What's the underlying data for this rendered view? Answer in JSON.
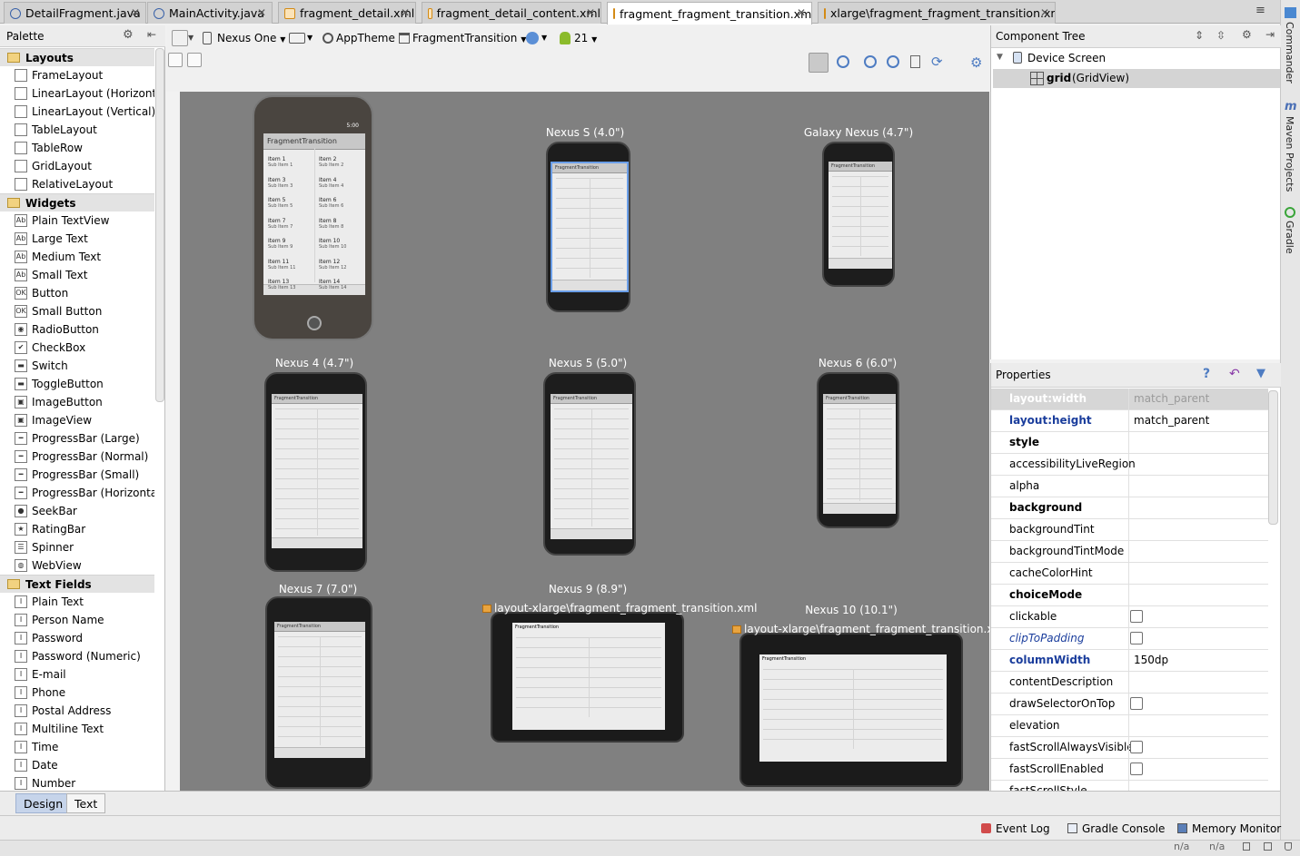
{
  "tabs": [
    {
      "label": "DetailFragment.java",
      "type": "java",
      "active": false
    },
    {
      "label": "MainActivity.java",
      "type": "java",
      "active": false
    },
    {
      "label": "fragment_detail.xml",
      "type": "xml",
      "active": false
    },
    {
      "label": "fragment_detail_content.xml",
      "type": "xml",
      "active": false
    },
    {
      "label": "fragment_fragment_transition.xml",
      "type": "xml",
      "active": true
    },
    {
      "label": "xlarge\\fragment_fragment_transition.xml",
      "type": "xml",
      "active": false
    }
  ],
  "tab_overflow": "≡",
  "side_tools": {
    "commander": "Commander",
    "maven": "Maven Projects",
    "gradle": "Gradle"
  },
  "palette": {
    "title": "Palette",
    "categories": [
      {
        "name": "Layouts",
        "items": [
          {
            "label": "FrameLayout",
            "icon": "frame-layout-icon"
          },
          {
            "label": "LinearLayout (Horizontal)",
            "icon": "linear-horizontal-icon"
          },
          {
            "label": "LinearLayout (Vertical)",
            "icon": "linear-vertical-icon"
          },
          {
            "label": "TableLayout",
            "icon": "table-layout-icon"
          },
          {
            "label": "TableRow",
            "icon": "table-row-icon"
          },
          {
            "label": "GridLayout",
            "icon": "grid-layout-icon"
          },
          {
            "label": "RelativeLayout",
            "icon": "relative-layout-icon"
          }
        ]
      },
      {
        "name": "Widgets",
        "items": [
          {
            "label": "Plain TextView",
            "icon": "textview-icon",
            "glyph": "Ab"
          },
          {
            "label": "Large Text",
            "icon": "textview-icon",
            "glyph": "Ab"
          },
          {
            "label": "Medium Text",
            "icon": "textview-icon",
            "glyph": "Ab"
          },
          {
            "label": "Small Text",
            "icon": "textview-icon",
            "glyph": "Ab"
          },
          {
            "label": "Button",
            "icon": "button-icon",
            "glyph": "OK"
          },
          {
            "label": "Small Button",
            "icon": "button-icon",
            "glyph": "OK"
          },
          {
            "label": "RadioButton",
            "icon": "radio-button-icon",
            "glyph": "◉"
          },
          {
            "label": "CheckBox",
            "icon": "checkbox-icon",
            "glyph": "✔"
          },
          {
            "label": "Switch",
            "icon": "switch-icon",
            "glyph": "▬"
          },
          {
            "label": "ToggleButton",
            "icon": "toggle-button-icon",
            "glyph": "▬"
          },
          {
            "label": "ImageButton",
            "icon": "image-button-icon",
            "glyph": "▣"
          },
          {
            "label": "ImageView",
            "icon": "image-view-icon",
            "glyph": "▣"
          },
          {
            "label": "ProgressBar (Large)",
            "icon": "progress-bar-icon",
            "glyph": "━"
          },
          {
            "label": "ProgressBar (Normal)",
            "icon": "progress-bar-icon",
            "glyph": "━"
          },
          {
            "label": "ProgressBar (Small)",
            "icon": "progress-bar-icon",
            "glyph": "━"
          },
          {
            "label": "ProgressBar (Horizontal)",
            "icon": "progress-bar-icon",
            "glyph": "━"
          },
          {
            "label": "SeekBar",
            "icon": "seek-bar-icon",
            "glyph": "●"
          },
          {
            "label": "RatingBar",
            "icon": "rating-bar-icon",
            "glyph": "★"
          },
          {
            "label": "Spinner",
            "icon": "spinner-icon",
            "glyph": "☰"
          },
          {
            "label": "WebView",
            "icon": "web-view-icon",
            "glyph": "◍"
          }
        ]
      },
      {
        "name": "Text Fields",
        "items": [
          {
            "label": "Plain Text",
            "icon": "text-field-icon",
            "glyph": "I"
          },
          {
            "label": "Person Name",
            "icon": "text-field-icon",
            "glyph": "I"
          },
          {
            "label": "Password",
            "icon": "text-field-icon",
            "glyph": "I"
          },
          {
            "label": "Password (Numeric)",
            "icon": "text-field-icon",
            "glyph": "I"
          },
          {
            "label": "E-mail",
            "icon": "text-field-icon",
            "glyph": "I"
          },
          {
            "label": "Phone",
            "icon": "text-field-icon",
            "glyph": "I"
          },
          {
            "label": "Postal Address",
            "icon": "text-field-icon",
            "glyph": "I"
          },
          {
            "label": "Multiline Text",
            "icon": "text-field-icon",
            "glyph": "I"
          },
          {
            "label": "Time",
            "icon": "text-field-icon",
            "glyph": "I"
          },
          {
            "label": "Date",
            "icon": "text-field-icon",
            "glyph": "I"
          },
          {
            "label": "Number",
            "icon": "text-field-icon",
            "glyph": "I"
          }
        ]
      }
    ]
  },
  "toolbar": {
    "device": "Nexus One",
    "theme": "AppTheme",
    "activity": "FragmentTransition",
    "api": "21"
  },
  "canvas": {
    "app_title": "FragmentTransition",
    "status_time": "5:00",
    "xml_link": "layout-xlarge\\fragment_fragment_transition.xml",
    "devices": [
      {
        "label": ""
      },
      {
        "label": "Nexus S (4.0\")"
      },
      {
        "label": "Galaxy Nexus (4.7\")"
      },
      {
        "label": "Nexus 4 (4.7\")"
      },
      {
        "label": "Nexus 5 (5.0\")"
      },
      {
        "label": "Nexus 6 (6.0\")"
      },
      {
        "label": "Nexus 7 (7.0\")"
      },
      {
        "label": "Nexus 9 (8.9\")"
      },
      {
        "label": "Nexus 10 (10.1\")"
      }
    ],
    "grid_items": [
      [
        "Item 1",
        "Sub Item 1",
        "Item 2",
        "Sub Item 2"
      ],
      [
        "Item 3",
        "Sub Item 3",
        "Item 4",
        "Sub Item 4"
      ],
      [
        "Item 5",
        "Sub Item 5",
        "Item 6",
        "Sub Item 6"
      ],
      [
        "Item 7",
        "Sub Item 7",
        "Item 8",
        "Sub Item 8"
      ],
      [
        "Item 9",
        "Sub Item 9",
        "Item 10",
        "Sub Item 10"
      ],
      [
        "Item 11",
        "Sub Item 11",
        "Item 12",
        "Sub Item 12"
      ],
      [
        "Item 13",
        "Sub Item 13",
        "Item 14",
        "Sub Item 14"
      ]
    ]
  },
  "component_tree": {
    "title": "Component Tree",
    "root": "Device Screen",
    "child_id": "grid",
    "child_type": "(GridView)"
  },
  "properties": {
    "title": "Properties",
    "rows": [
      {
        "name": "layout:width",
        "value": "match_parent",
        "style": "selected"
      },
      {
        "name": "layout:height",
        "value": "match_parent",
        "style": "blue"
      },
      {
        "name": "style",
        "value": "",
        "style": "bold"
      },
      {
        "name": "accessibilityLiveRegion",
        "value": "",
        "style": "normal"
      },
      {
        "name": "alpha",
        "value": "",
        "style": "normal"
      },
      {
        "name": "background",
        "value": "",
        "style": "bold"
      },
      {
        "name": "backgroundTint",
        "value": "",
        "style": "normal"
      },
      {
        "name": "backgroundTintMode",
        "value": "",
        "style": "normal"
      },
      {
        "name": "cacheColorHint",
        "value": "",
        "style": "normal"
      },
      {
        "name": "choiceMode",
        "value": "",
        "style": "bold"
      },
      {
        "name": "clickable",
        "value": "",
        "style": "normal",
        "checkbox": true
      },
      {
        "name": "clipToPadding",
        "value": "",
        "style": "italic",
        "checkbox": true
      },
      {
        "name": "columnWidth",
        "value": "150dp",
        "style": "blue"
      },
      {
        "name": "contentDescription",
        "value": "",
        "style": "normal"
      },
      {
        "name": "drawSelectorOnTop",
        "value": "",
        "style": "normal",
        "checkbox": true
      },
      {
        "name": "elevation",
        "value": "",
        "style": "normal"
      },
      {
        "name": "fastScrollAlwaysVisible",
        "value": "",
        "style": "normal",
        "checkbox": true
      },
      {
        "name": "fastScrollEnabled",
        "value": "",
        "style": "normal",
        "checkbox": true
      },
      {
        "name": "fastScrollStyle",
        "value": "",
        "style": "normal"
      }
    ]
  },
  "editor_tabs": {
    "design": "Design",
    "text": "Text"
  },
  "status": {
    "event_log": "Event Log",
    "gradle_console": "Gradle Console",
    "memory_monitor": "Memory Monitor",
    "na1": "n/a",
    "na2": "n/a"
  },
  "colors": {
    "accent": "#3a62a8",
    "canvas": "#808080",
    "link": "#1a3d9c"
  }
}
